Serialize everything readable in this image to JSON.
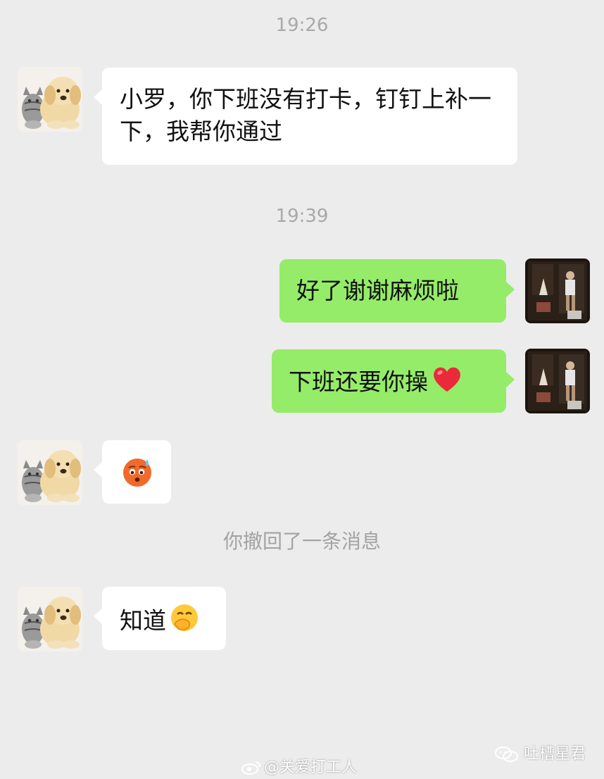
{
  "timestamps": [
    "19:26",
    "19:39"
  ],
  "messages": [
    {
      "text": "小罗，你下班没有打卡，钉钉上补一下，我帮你通过"
    },
    {
      "text": "好了谢谢麻烦啦"
    },
    {
      "text": "下班还要你操",
      "emoji": "red-heart-icon"
    },
    {
      "emoji": "anxious-sweat-face-icon"
    },
    {
      "text": "知道",
      "emoji": "hand-over-mouth-face-icon"
    }
  ],
  "system_note": "你撤回了一条消息",
  "watermarks": {
    "weibo": "@关爱打工人",
    "wechat": "吐槽星君"
  },
  "colors": {
    "background": "#ececec",
    "incoming_bubble": "#ffffff",
    "outgoing_bubble": "#95ec69"
  }
}
